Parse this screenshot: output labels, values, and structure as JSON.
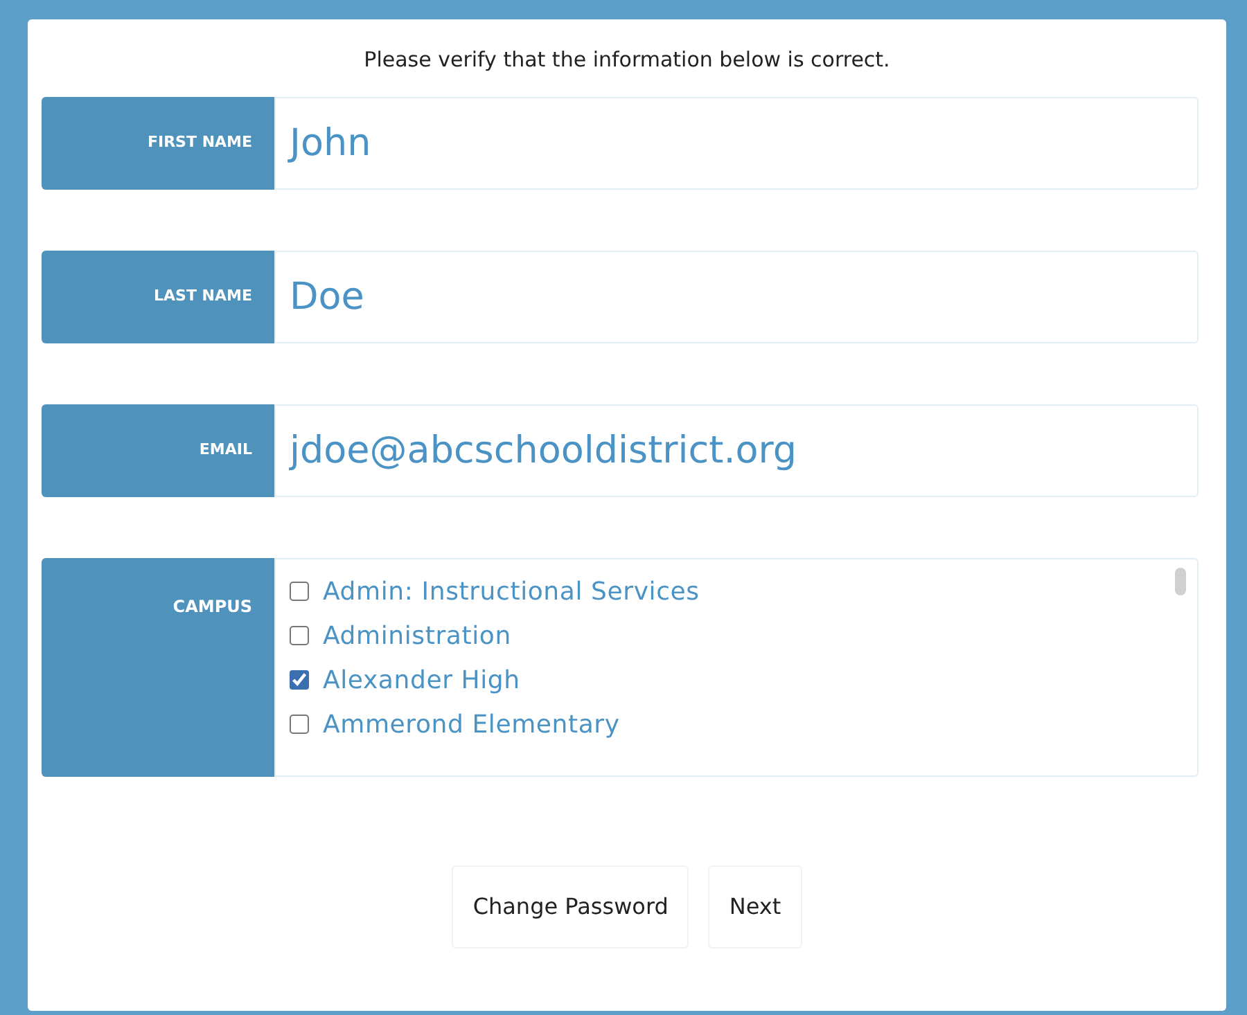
{
  "intro": "Please verify that the information below is correct.",
  "fields": [
    {
      "label": "FIRST NAME",
      "value": "John"
    },
    {
      "label": "LAST NAME",
      "value": "Doe"
    },
    {
      "label": "EMAIL",
      "value": "jdoe@abcschooldistrict.org"
    }
  ],
  "campus": {
    "label": "CAMPUS",
    "options": [
      {
        "label": "Admin: Instructional Services",
        "checked": false
      },
      {
        "label": "Administration",
        "checked": false
      },
      {
        "label": "Alexander High",
        "checked": true
      },
      {
        "label": "Ammerond Elementary",
        "checked": false
      }
    ]
  },
  "buttons": [
    "Change Password",
    "Next"
  ]
}
